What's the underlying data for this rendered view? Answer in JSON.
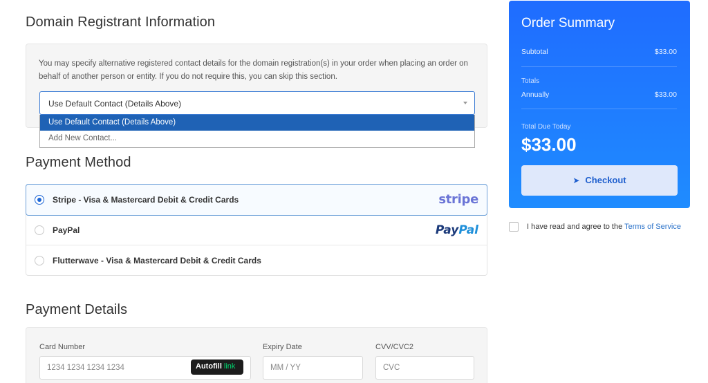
{
  "registrant": {
    "heading": "Domain Registrant Information",
    "description": "You may specify alternative registered contact details for the domain registration(s) in your order when placing an order on behalf of another person or entity. If you do not require this, you can skip this section.",
    "select_value": "Use Default Contact (Details Above)",
    "options": [
      "Use Default Contact (Details Above)",
      "Add New Contact..."
    ]
  },
  "payment_method": {
    "heading": "Payment Method",
    "methods": [
      {
        "label": "Stripe - Visa & Mastercard Debit & Credit Cards",
        "logo": "stripe",
        "selected": true
      },
      {
        "label": "PayPal",
        "logo_a": "Pay",
        "logo_b": "Pal",
        "selected": false
      },
      {
        "label": "Flutterwave - Visa & Mastercard Debit & Credit Cards",
        "selected": false
      }
    ]
  },
  "payment_details": {
    "heading": "Payment Details",
    "card_label": "Card Number",
    "card_placeholder": "1234 1234 1234 1234",
    "autofill_a": "Autofill",
    "autofill_b": "link",
    "expiry_label": "Expiry Date",
    "expiry_placeholder": "MM / YY",
    "cvv_label": "CVV/CVC2",
    "cvv_placeholder": "CVC"
  },
  "summary": {
    "title": "Order Summary",
    "subtotal_label": "Subtotal",
    "subtotal_value": "$33.00",
    "totals_label": "Totals",
    "annually_label": "Annually",
    "annually_value": "$33.00",
    "due_label": "Total Due Today",
    "due_value": "$33.00",
    "checkout_label": "Checkout",
    "gradient_top": "#1f6cff",
    "gradient_bottom": "#1f8cff"
  },
  "tos": {
    "text": "I have read and agree to the ",
    "link": "Terms of Service"
  }
}
